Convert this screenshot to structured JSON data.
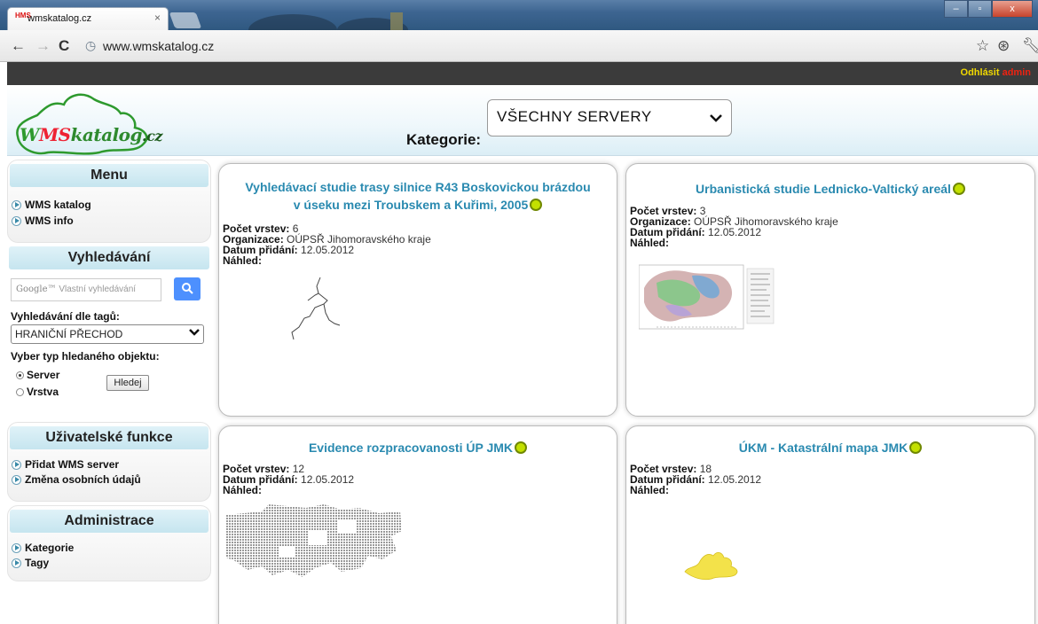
{
  "browser": {
    "tab_title": "wmskatalog.cz",
    "tab_favicon": "HMS",
    "tab_close": "×",
    "url": "www.wmskatalog.cz",
    "window_buttons": [
      "–",
      "▫",
      "x"
    ]
  },
  "adminbar": {
    "logout_label": "Odhlásit",
    "user_label": "admin"
  },
  "header": {
    "logo": {
      "w": "W",
      "ms": "MS",
      "katalog": "katalog",
      "cz": ".cz"
    },
    "kategorie_label": "Kategorie:",
    "kategorie_value": "VŠECHNY SERVERY"
  },
  "sidebar": {
    "menu": {
      "title": "Menu",
      "items": [
        "WMS katalog",
        "WMS info"
      ]
    },
    "search": {
      "title": "Vyhledávání",
      "google_prefix": "Google™",
      "placeholder": "Vlastní vyhledávání",
      "tags_label": "Vyhledávání dle tagů:",
      "tag_value": "HRANIČNÍ PŘECHOD",
      "type_label": "Vyber typ hledaného objektu:",
      "radio_server": "Server",
      "radio_vrstva": "Vrstva",
      "submit_label": "Hledej",
      "selected_type": "Server"
    },
    "user_functions": {
      "title": "Uživatelské funkce",
      "items": [
        "Přidat WMS server",
        "Změna osobních údajů"
      ]
    },
    "admin": {
      "title": "Administrace",
      "items": [
        "Kategorie",
        "Tagy"
      ]
    }
  },
  "labels": {
    "pocet_vrstev": "Počet vrstev:",
    "organizace": "Organizace:",
    "datum_pridani": "Datum přidání:",
    "nahled": "Náhled:"
  },
  "cards": [
    {
      "title_line1": "Vyhledávací studie trasy silnice R43 Boskovickou brázdou",
      "title_line2": "v úseku mezi Troubskem a Kuřimi, 2005",
      "layers": "6",
      "organization": "OÚPSŘ Jihomoravského kraje",
      "date": "12.05.2012"
    },
    {
      "title": "Urbanistická studie Lednicko-Valtický areál",
      "layers": "3",
      "organization": "OÚPSŘ Jihomoravského kraje",
      "date": "12.05.2012"
    },
    {
      "title": "Evidence rozpracovanosti ÚP JMK",
      "layers": "12",
      "date": "12.05.2012"
    },
    {
      "title": "ÚKM - Katastrální mapa JMK",
      "layers": "18",
      "date": "12.05.2012"
    }
  ],
  "colors": {
    "link_blue": "#2a8ab0",
    "status_green": "#c3e000",
    "admin_bar": "#3b3b3b",
    "logout_yellow": "#f0d800",
    "user_red": "#e21"
  }
}
